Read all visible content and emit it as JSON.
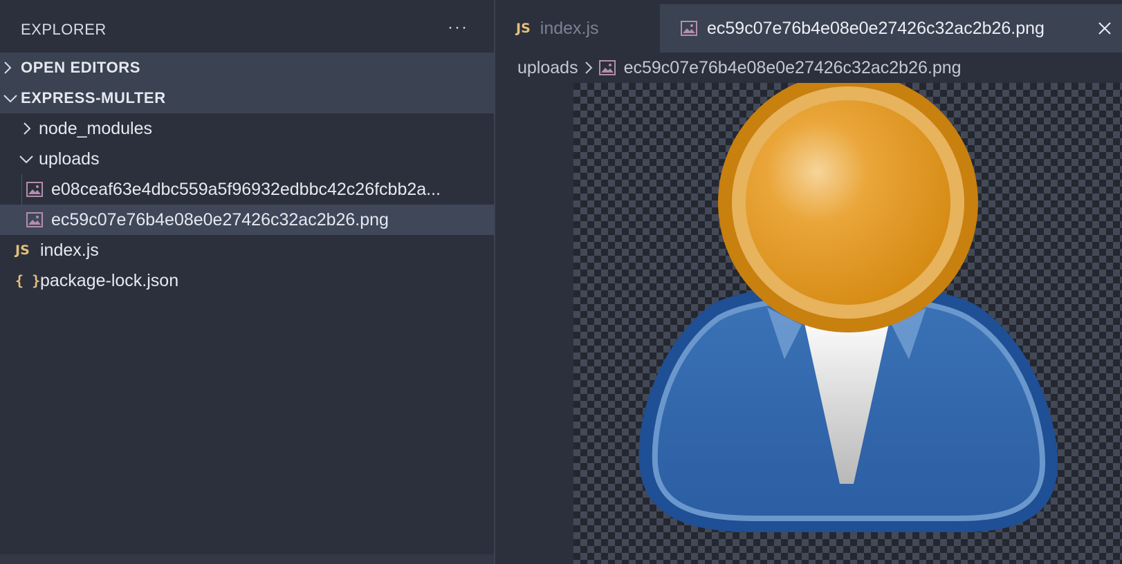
{
  "sidebar": {
    "title": "EXPLORER",
    "more_label": "···",
    "sections": {
      "open_editors": "OPEN EDITORS",
      "project": "EXPRESS-MULTER"
    },
    "tree": {
      "node_modules": "node_modules",
      "uploads": "uploads",
      "file1": "e08ceaf63e4dbc559a5f96932edbbc42c26fcbb2a...",
      "file2": "ec59c07e76b4e08e0e27426c32ac2b26.png",
      "index": "index.js",
      "package_lock": "package-lock.json"
    }
  },
  "tabs": {
    "index": {
      "badge": "JS",
      "label": "index.js"
    },
    "active": {
      "label": "ec59c07e76b4e08e0e27426c32ac2b26.png"
    }
  },
  "badges": {
    "js": "JS",
    "json": "{ }"
  },
  "breadcrumb": {
    "folder": "uploads",
    "file": "ec59c07e76b4e08e0e27426c32ac2b26.png"
  },
  "icons": {
    "image_file": "image-icon",
    "chevron_right": "chevron-right-icon",
    "chevron_down": "chevron-down-icon",
    "close": "close-icon"
  },
  "colors": {
    "sidebar_bg": "#2b303c",
    "section_bg": "#3b4252",
    "selected_bg": "#3f4759",
    "image_icon": "#b48ead",
    "js_badge": "#e5c07b"
  }
}
